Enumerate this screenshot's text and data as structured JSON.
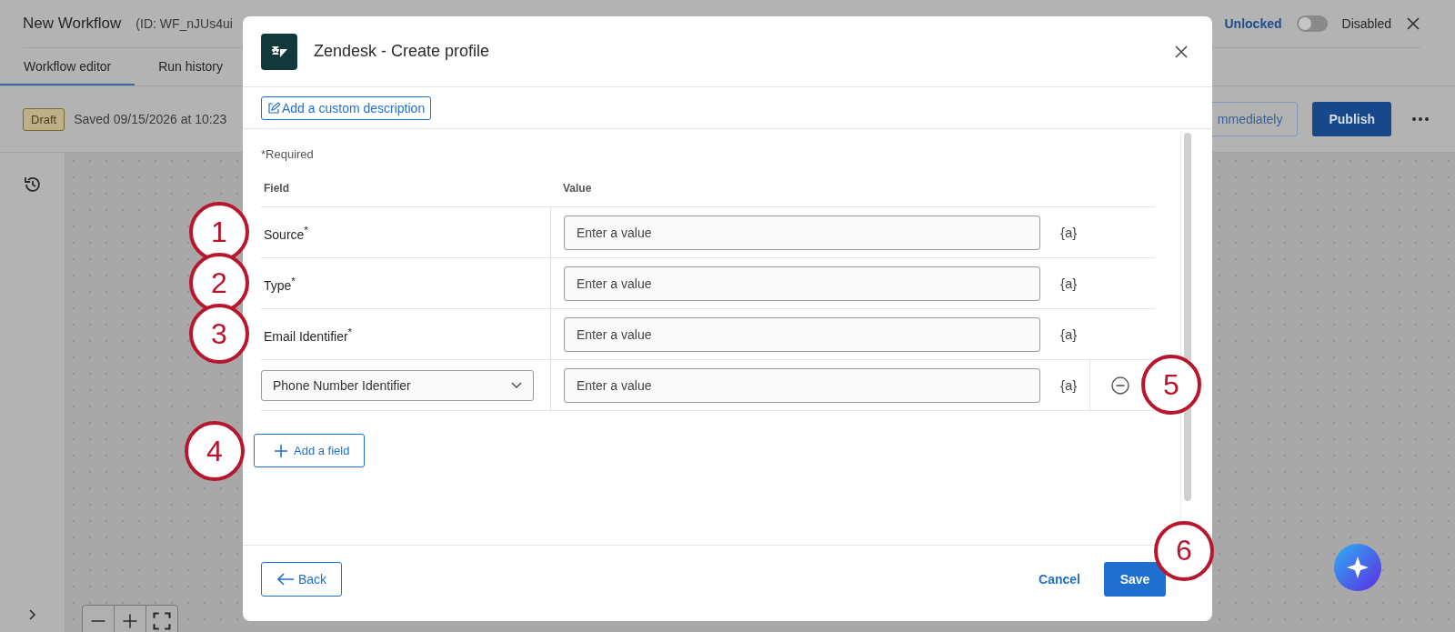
{
  "app": {
    "title": "New Workflow",
    "workflow_id": "(ID: WF_nJUs4ui",
    "lock_status": "Unlocked",
    "toggle": {
      "label": "Disabled",
      "on": false
    },
    "tabs": [
      {
        "label": "Workflow editor",
        "selected": true
      },
      {
        "label": "Run history",
        "selected": false
      }
    ],
    "status_badge": "Draft",
    "saved_text": "Saved 09/15/2026 at 10:23",
    "secondary_button": "mmediately",
    "publish_button": "Publish"
  },
  "modal": {
    "title": "Zendesk - Create profile",
    "description_button": "Add a custom description",
    "required_note": "*Required",
    "columns": [
      "Field",
      "Value"
    ],
    "rows": [
      {
        "kind": "label",
        "field": "Source$^{*}$",
        "placeholder": "Enter a value",
        "insert": "{a}",
        "removable": false,
        "callout": "1"
      },
      {
        "kind": "label",
        "field": "Type$^{*}$",
        "placeholder": "Enter a value",
        "insert": "{a}",
        "removable": false,
        "callout": "2"
      },
      {
        "kind": "label",
        "field": "Email Identifier$^{*}$",
        "placeholder": "Enter a value",
        "insert": "{a}",
        "removable": false,
        "callout": "3"
      },
      {
        "kind": "select",
        "field": "Phone Number Identifier",
        "placeholder": "Enter a value",
        "insert": "{a}",
        "removable": true,
        "callout": "5"
      }
    ],
    "add_button": {
      "label": "Add a field",
      "callout": "4"
    },
    "back_button": "Back",
    "cancel_button": "Cancel",
    "save_button": {
      "label": "Save",
      "callout": "6"
    }
  }
}
